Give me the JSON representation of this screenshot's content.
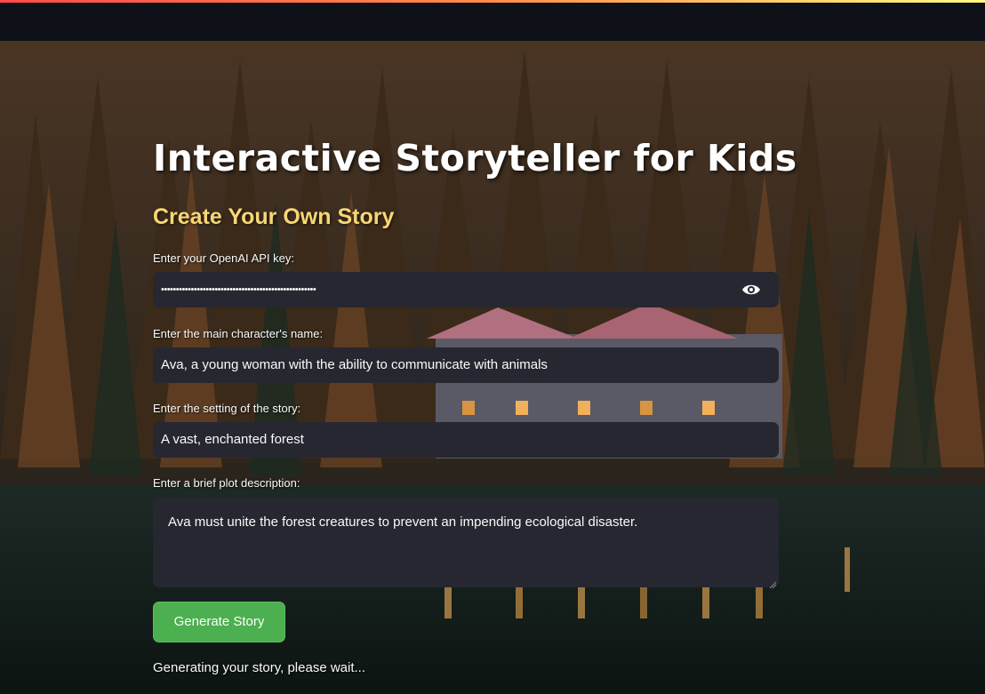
{
  "app": {
    "title": "Interactive Storyteller for Kids",
    "subtitle": "Create Your Own Story"
  },
  "form": {
    "api_key": {
      "label": "Enter your OpenAI API key:",
      "masked_value": "••••••••••••••••••••••••••••••••••••••••••••••••••••",
      "toggle_icon": "eye-icon"
    },
    "character": {
      "label": "Enter the main character's name:",
      "value": "Ava, a young woman with the ability to communicate with animals"
    },
    "setting": {
      "label": "Enter the setting of the story:",
      "value": "A vast, enchanted forest"
    },
    "plot": {
      "label": "Enter a brief plot description:",
      "value": "Ava must unite the forest creatures to prevent an impending ecological disaster."
    },
    "submit_label": "Generate Story"
  },
  "status": {
    "message": "Generating your story, please wait..."
  },
  "colors": {
    "title": "#ffffff",
    "subtitle": "#f7d774",
    "input_bg": "#262730",
    "button_bg": "#4caf50",
    "header_bg": "#0e1117"
  }
}
